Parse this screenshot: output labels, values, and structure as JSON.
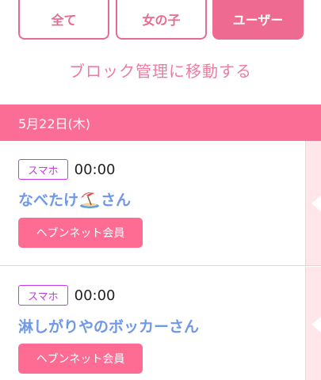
{
  "tabs": [
    {
      "label": "全て",
      "active": false
    },
    {
      "label": "女の子",
      "active": false
    },
    {
      "label": "ユーザー",
      "active": true
    }
  ],
  "block_link": "ブロック管理に移動する",
  "date_header": "5月22日(木)",
  "items": [
    {
      "device": "スマホ",
      "time": "00:00",
      "name_before_icon": "なべたけ",
      "icon": "beach-umbrella-icon",
      "name_after_icon": "さん",
      "badge": "ヘブンネット会員"
    },
    {
      "device": "スマホ",
      "time": "00:00",
      "name": "淋しがりやのボッカーさん",
      "badge": "ヘブンネット会員"
    }
  ],
  "colors": {
    "accent": "#ef6a90",
    "date_header": "#fb6d95",
    "name": "#6f98e8",
    "device_badge": "#c63aee",
    "side_strip": "#ffe6ea"
  }
}
